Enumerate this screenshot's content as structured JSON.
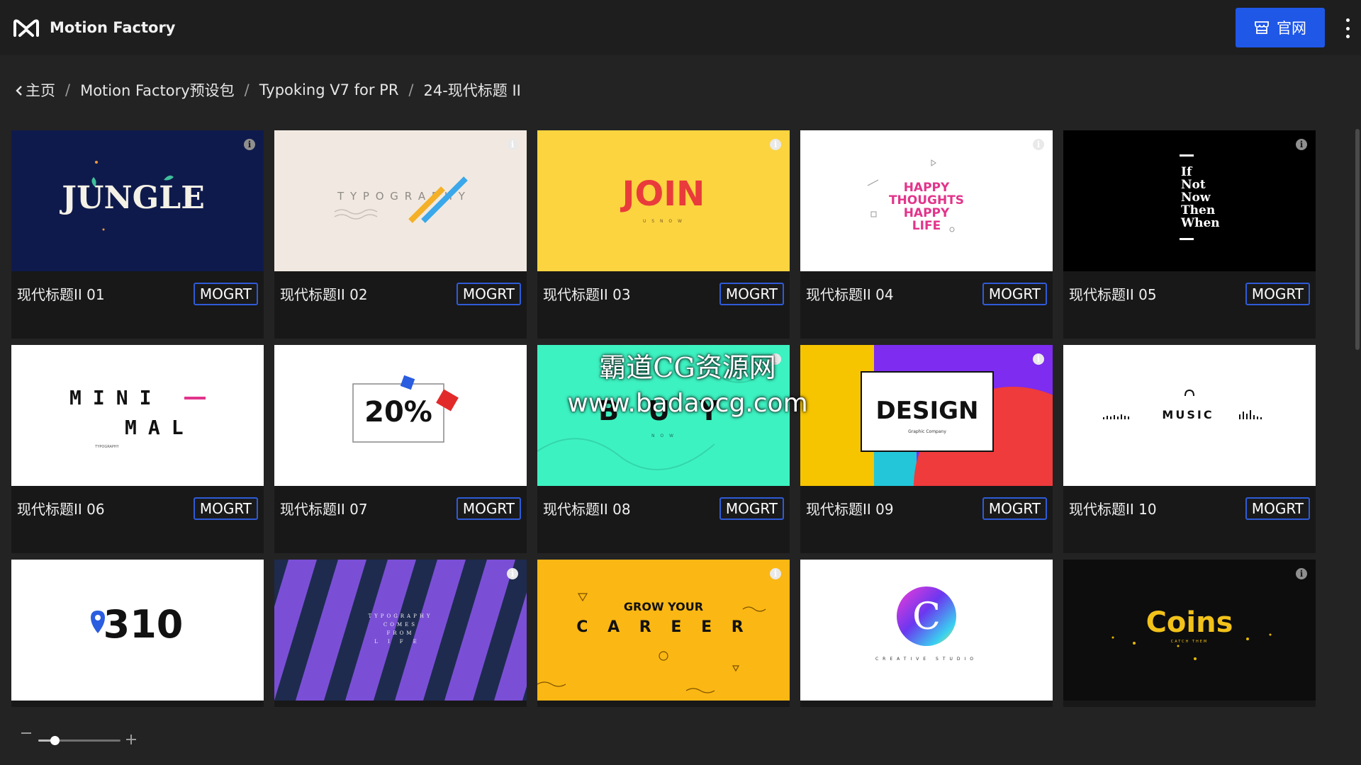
{
  "header": {
    "app_title": "Motion Factory",
    "site_button_label": "官网"
  },
  "breadcrumb": {
    "home": "主页",
    "level1": "Motion Factory预设包",
    "level2": "Typoking V7 for PR",
    "current": "24-现代标题 II",
    "separator": "/"
  },
  "cards": [
    {
      "title": "现代标题II 01",
      "badge": "MOGRT",
      "thumb_text": "JUNGLE"
    },
    {
      "title": "现代标题II 02",
      "badge": "MOGRT",
      "thumb_text": "T Y P O G R A P H Y"
    },
    {
      "title": "现代标题II 03",
      "badge": "MOGRT",
      "thumb_text": "JOIN",
      "thumb_sub": "U S  N O W"
    },
    {
      "title": "现代标题II 04",
      "badge": "MOGRT",
      "thumb_text": "HAPPY THOUGHTS HAPPY LIFE"
    },
    {
      "title": "现代标题II 05",
      "badge": "MOGRT",
      "thumb_text": "If Not Now Then When"
    },
    {
      "title": "现代标题II 06",
      "badge": "MOGRT",
      "thumb_text": "M I N I MAL",
      "thumb_sub": "TYPOGRAPHY"
    },
    {
      "title": "现代标题II 07",
      "badge": "MOGRT",
      "thumb_text": "20%"
    },
    {
      "title": "现代标题II 08",
      "badge": "MOGRT",
      "thumb_text": "B U Y",
      "thumb_sub": "N O W"
    },
    {
      "title": "现代标题II 09",
      "badge": "MOGRT",
      "thumb_text": "DESIGN",
      "thumb_sub": "Graphic Company"
    },
    {
      "title": "现代标题II 10",
      "badge": "MOGRT",
      "thumb_text": "MUSIC"
    },
    {
      "title": "",
      "badge": "",
      "thumb_text": "310"
    },
    {
      "title": "",
      "badge": "",
      "thumb_text": "TYPOGRAPHY COMES FROM LIFE"
    },
    {
      "title": "",
      "badge": "",
      "thumb_text": "GROW YOUR",
      "thumb_sub": "C A R E E R"
    },
    {
      "title": "",
      "badge": "",
      "thumb_text": "C",
      "thumb_sub": "CREATIVE STUDIO"
    },
    {
      "title": "",
      "badge": "",
      "thumb_text": "Coins",
      "thumb_sub": "CATCH THEM"
    }
  ],
  "zoom": {
    "level": 0.2
  },
  "watermark": {
    "line1": "霸道CG资源网",
    "line2": "www.badaocg.com"
  },
  "icons": {
    "logo": "motion-factory-logo-icon",
    "site": "store-icon",
    "menu": "kebab-menu-icon",
    "info": "info-icon",
    "back": "chevron-left-icon"
  },
  "colors": {
    "accent": "#1f57e7",
    "badge_border": "#2f5bd8",
    "background": "#232323",
    "card": "#181818"
  }
}
